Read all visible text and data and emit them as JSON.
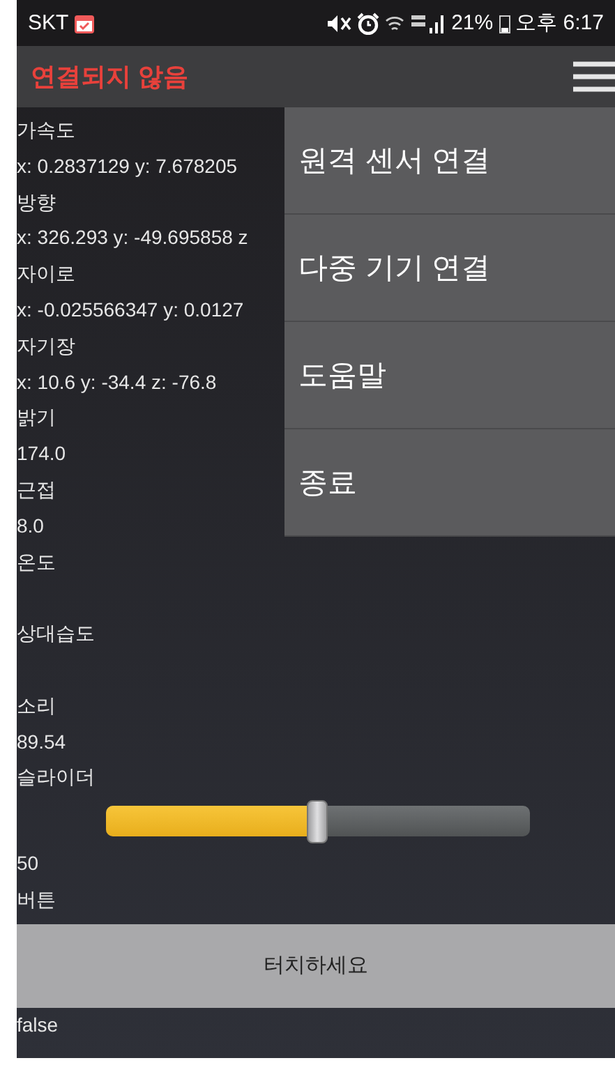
{
  "status_bar": {
    "carrier": "SKT",
    "battery": "21%",
    "time": "오후 6:17"
  },
  "app_bar": {
    "title": "연결되지 않음"
  },
  "sensors": [
    {
      "label": "가속도",
      "reading": "x: 0.2837129 y: 7.678205"
    },
    {
      "label": "방향",
      "reading": "x: 326.293 y: -49.695858 z"
    },
    {
      "label": "자이로",
      "reading": "x: -0.025566347 y: 0.0127"
    },
    {
      "label": "자기장",
      "reading": "x: 10.6 y: -34.4 z: -76.8"
    },
    {
      "label": "밝기",
      "reading": "174.0"
    },
    {
      "label": "근접",
      "reading": "8.0"
    },
    {
      "label": "온도"
    },
    {
      "label": "상대습도"
    },
    {
      "label": "소리",
      "reading": "89.54"
    }
  ],
  "slider": {
    "label": "슬라이더",
    "level": 0.5,
    "value": "50"
  },
  "button": {
    "label": "버튼",
    "text": "터치하세요",
    "state": "false"
  },
  "menu": [
    {
      "label": "원격 센서 연결"
    },
    {
      "label": "다중 기기 연결"
    },
    {
      "label": "도움말"
    },
    {
      "label": "종료"
    }
  ]
}
